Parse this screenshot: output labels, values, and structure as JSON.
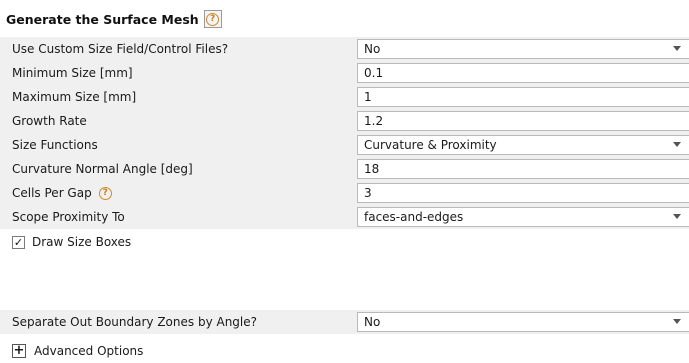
{
  "panel": {
    "title": "Generate the Surface Mesh",
    "help_glyph": "?"
  },
  "rows": [
    {
      "label": "Use Custom Size Field/Control Files?",
      "type": "dropdown",
      "value": "No"
    },
    {
      "label": "Minimum Size [mm]",
      "type": "input",
      "value": "0.1"
    },
    {
      "label": "Maximum Size [mm]",
      "type": "input",
      "value": "1"
    },
    {
      "label": "Growth Rate",
      "type": "input",
      "value": "1.2"
    },
    {
      "label": "Size Functions",
      "type": "dropdown",
      "value": "Curvature & Proximity"
    },
    {
      "label": "Curvature Normal Angle [deg]",
      "type": "input",
      "value": "18"
    },
    {
      "label": "Cells Per Gap",
      "type": "input",
      "value": "3",
      "has_help": true
    },
    {
      "label": "Scope Proximity To",
      "type": "dropdown",
      "value": "faces-and-edges"
    }
  ],
  "draw_size_boxes": {
    "label": "Draw Size Boxes",
    "checked": true,
    "check_glyph": "✓"
  },
  "separate_zones": {
    "label": "Separate Out Boundary Zones by Angle?",
    "type": "dropdown",
    "value": "No"
  },
  "advanced": {
    "label": "Advanced Options",
    "expand_glyph": "+"
  },
  "icons": {
    "help": "help-icon",
    "dropdown": "chevron-down-icon",
    "expand": "plus-icon"
  },
  "colors": {
    "help_accent": "#c77d1e",
    "row_bg": "#f0f0f0"
  }
}
